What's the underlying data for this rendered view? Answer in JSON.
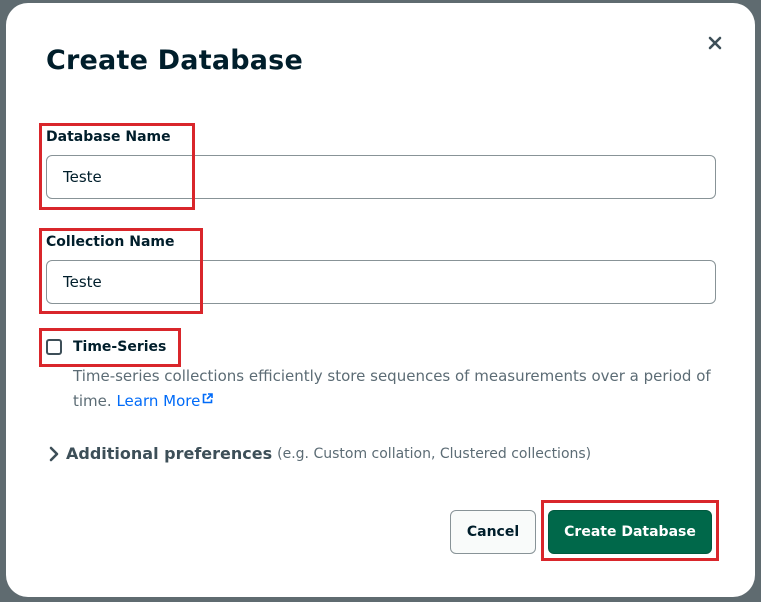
{
  "dialog": {
    "title": "Create Database",
    "close_icon": "close-icon"
  },
  "database_name": {
    "label": "Database Name",
    "value": "Teste"
  },
  "collection_name": {
    "label": "Collection Name",
    "value": "Teste"
  },
  "time_series": {
    "label": "Time-Series",
    "checked": false,
    "description": "Time-series collections efficiently store sequences of measurements over a period of time.",
    "learn_more": "Learn More",
    "learn_more_icon": "external-link-icon"
  },
  "additional_preferences": {
    "label": "Additional preferences",
    "hint": "(e.g. Custom collation, Clustered collections)",
    "icon": "chevron-right-icon"
  },
  "buttons": {
    "cancel": "Cancel",
    "create": "Create Database"
  },
  "colors": {
    "primary_button": "#00684a",
    "link": "#016bf8",
    "highlight_annotation": "#d9262b"
  }
}
